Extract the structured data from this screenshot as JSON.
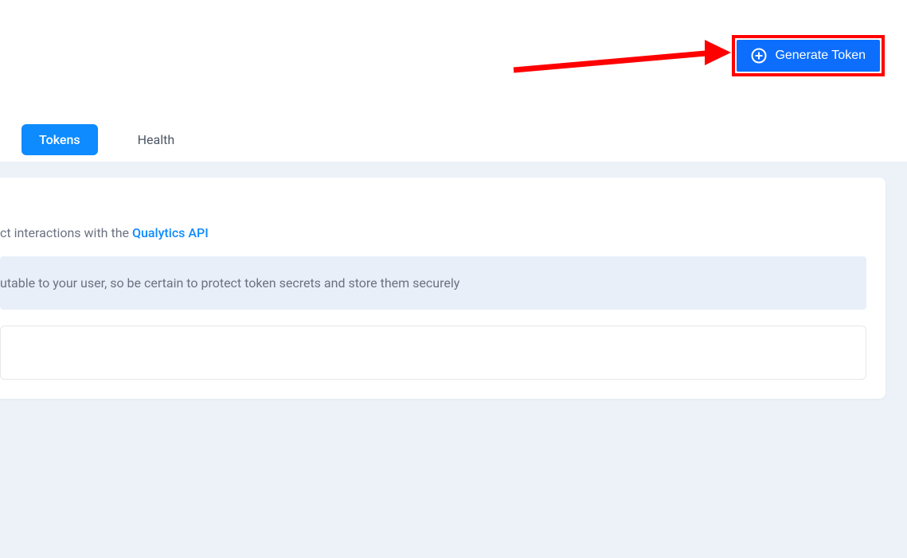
{
  "header": {
    "generate_button_label": "Generate Token"
  },
  "tabs": {
    "tokens_label": "Tokens",
    "health_label": "Health"
  },
  "content": {
    "description_prefix": "ct interactions with the ",
    "api_link_text": "Qualytics API",
    "info_banner_text": "utable to your user, so be certain to protect token secrets and store them securely"
  }
}
